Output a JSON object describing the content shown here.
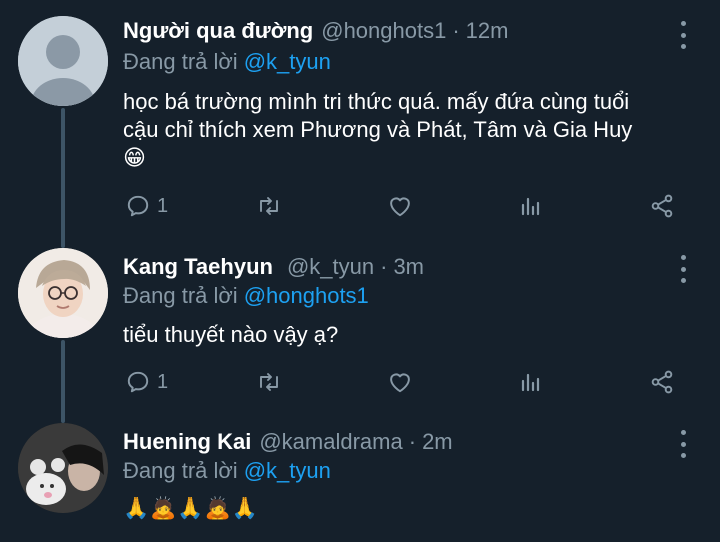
{
  "colors": {
    "background": "#15202b",
    "muted": "#8899a6",
    "link": "#1da1f2",
    "thread_line": "#3d5466"
  },
  "tweets": [
    {
      "display_name": "Người qua đường",
      "handle": "@honghots1",
      "separator": "·",
      "time": "12m",
      "reply_prefix": "Đang trả lời",
      "reply_to": "@k_tyun",
      "text_lines": [
        "học bá trường mình tri thức quá. mấy đứa cùng tuổi",
        "cậu chỉ thích xem Phương và Phát, Tâm và Gia Huy"
      ],
      "emoji": "😁",
      "reply_count": "1",
      "avatar": "default-avatar"
    },
    {
      "display_name": "Kang Taehyun",
      "handle": "@k_tyun",
      "separator": "·",
      "time": "3m",
      "reply_prefix": "Đang trả lời",
      "reply_to": "@honghots1",
      "text_lines": [
        "tiểu thuyết nào vậy ạ?"
      ],
      "reply_count": "1",
      "avatar": "user-photo"
    },
    {
      "display_name": "Huening Kai",
      "handle": "@kamaldrama",
      "separator": "·",
      "time": "2m",
      "reply_prefix": "Đang trả lời",
      "reply_to": "@k_tyun",
      "emoji_line": "🙏🙇🙏🙇🙏",
      "avatar": "user-photo"
    }
  ],
  "icons": [
    "reply-icon",
    "retweet-icon",
    "like-icon",
    "analytics-icon",
    "share-icon",
    "more-options-icon"
  ]
}
